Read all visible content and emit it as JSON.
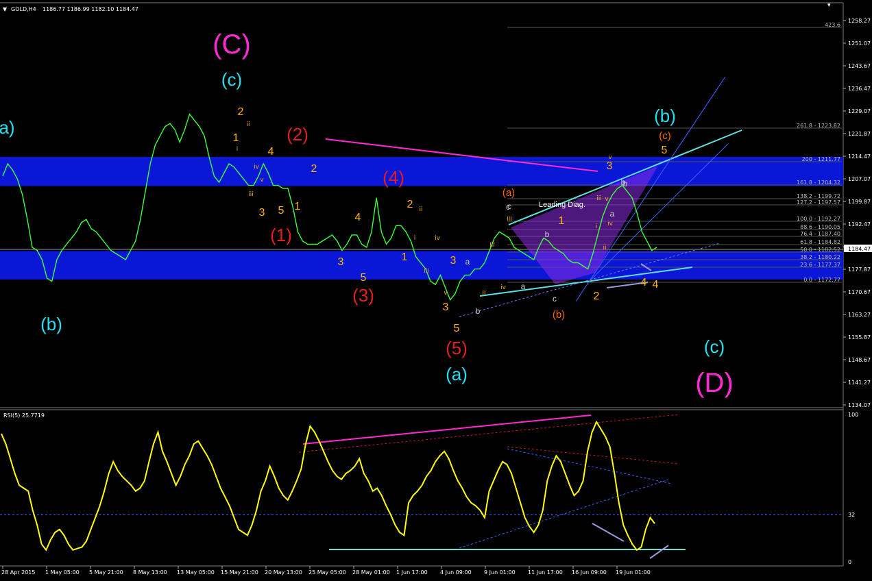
{
  "header": {
    "menu_glyph": "▼",
    "symbol": "GOLD,H4",
    "ohlc": "1186.77 1186.99 1182.10 1184.47"
  },
  "chart_data": {
    "type": "line",
    "title": "GOLD,H4",
    "ylim": [
      1134.07,
      1258.27
    ],
    "y_ticks": [
      "1258.27",
      "1251.07",
      "1243.67",
      "1236.47",
      "1229.07",
      "1221.87",
      "1214.47",
      "1207.07",
      "1199.87",
      "1192.47",
      "1185.27",
      "1177.87",
      "1170.67",
      "1163.27",
      "1155.87",
      "1148.67",
      "1141.27",
      "1134.07"
    ],
    "current_price": "1184.47",
    "x_ticks": [
      "28 Apr 2015",
      "1 May 05:00",
      "5 May 21:00",
      "8 May 13:00",
      "13 May 05:00",
      "15 May 21:00",
      "20 May 13:00",
      "25 May 05:00",
      "28 May 01:00",
      "1 Jun 17:00",
      "4 Jun 09:00",
      "9 Jun 01:00",
      "11 Jun 17:00",
      "16 Jun 09:00",
      "19 Jun 01:00"
    ],
    "price_series": [
      1208,
      1212,
      1210,
      1207,
      1202,
      1194,
      1185,
      1184,
      1181,
      1175,
      1174,
      1181,
      1184,
      1186,
      1188,
      1190,
      1193,
      1194,
      1191,
      1190,
      1188,
      1186,
      1184,
      1183,
      1182,
      1181,
      1184,
      1187,
      1194,
      1203,
      1212,
      1218,
      1221,
      1224,
      1225,
      1223,
      1219,
      1223,
      1228,
      1226,
      1224,
      1221,
      1214,
      1208,
      1206,
      1209,
      1212,
      1211,
      1209,
      1207,
      1205,
      1205,
      1208,
      1212,
      1209,
      1205,
      1205,
      1204,
      1204,
      1198,
      1190,
      1187,
      1186,
      1186,
      1186,
      1187,
      1188,
      1189,
      1187,
      1184,
      1186,
      1189,
      1189,
      1186,
      1185,
      1190,
      1201,
      1190,
      1186,
      1188,
      1192,
      1192,
      1190,
      1187,
      1182,
      1180,
      1178,
      1174,
      1173,
      1176,
      1172,
      1168,
      1170,
      1174,
      1176,
      1176,
      1178,
      1178,
      1180,
      1184,
      1188,
      1190,
      1189,
      1188,
      1185,
      1184,
      1183,
      1182,
      1181,
      1185,
      1188,
      1187,
      1185,
      1184,
      1183,
      1181,
      1180,
      1180,
      1179,
      1178,
      1183,
      1189,
      1195,
      1199,
      1202,
      1204,
      1205,
      1203,
      1201,
      1196,
      1190,
      1187,
      1184,
      1185
    ],
    "annotations": {
      "waves": [
        {
          "text": "(C)",
          "color": "#ff2bd0",
          "size": "big"
        },
        {
          "text": "(c)",
          "color": "#22e0f0"
        },
        {
          "text": "a)",
          "color": "#22e0f0"
        },
        {
          "text": "(b)",
          "color": "#22e0f0"
        },
        {
          "text": "(2)",
          "color": "#e02020"
        },
        {
          "text": "(1)",
          "color": "#e02020"
        },
        {
          "text": "(4)",
          "color": "#e02020"
        },
        {
          "text": "(3)",
          "color": "#e02020"
        },
        {
          "text": "(5)",
          "color": "#e02020"
        },
        {
          "text": "(a)",
          "color": "#22e0f0"
        },
        {
          "text": "(b)",
          "color": "#22e0f0"
        },
        {
          "text": "(c)",
          "color": "#22e0f0"
        },
        {
          "text": "(D)",
          "color": "#ff2bd0",
          "size": "big"
        },
        {
          "text": "(a)",
          "color": "#ff6a00",
          "size": "small"
        },
        {
          "text": "(b)",
          "color": "#ff6a00",
          "size": "small"
        },
        {
          "text": "(c)",
          "color": "#ff6a00",
          "size": "small"
        }
      ],
      "numbers": [
        "2",
        "1",
        "3",
        "4",
        "5",
        "1",
        "3",
        "2",
        "5",
        "4",
        "3",
        "1",
        "2",
        "4",
        "3",
        "5",
        "1",
        "3",
        "2",
        "4",
        "5",
        "a",
        "a",
        "b",
        "b",
        "c",
        "c",
        "b",
        "a",
        "b",
        "c"
      ],
      "roman": [
        "ii",
        "i",
        "iii",
        "iv",
        "v",
        "ii",
        "i",
        "iv",
        "iii",
        "v",
        "iii",
        "iv",
        "ii",
        "i",
        "ii",
        "iii",
        "iv",
        "v",
        "iii",
        "v"
      ],
      "leading_diag": "Leading Diag."
    },
    "fib_levels": [
      "423.6",
      "261.8 - 1223.82",
      "200 - 1211.77",
      "161.8 - 1204.32",
      "138.2 - 1199.72",
      "127.2 - 1197.57",
      "100.0 - 1192.27",
      "88.6 - 1190.05",
      "76.4 - 1187.40",
      "61.8 - 1184.82",
      "50.0 - 1182.52",
      "38.2 - 1180.22",
      "23.6 - 1177.37",
      "0.0 - 1172.77"
    ],
    "rsi": {
      "label": "RSI(5) 25.7719",
      "ylim": [
        0,
        100
      ],
      "y_ticks": [
        "100",
        "32",
        "0"
      ],
      "values": [
        87,
        80,
        70,
        60,
        52,
        50,
        48,
        35,
        25,
        12,
        8,
        15,
        20,
        22,
        18,
        12,
        8,
        9,
        10,
        14,
        22,
        30,
        38,
        48,
        60,
        68,
        62,
        58,
        55,
        52,
        48,
        50,
        55,
        68,
        80,
        88,
        75,
        68,
        60,
        52,
        58,
        66,
        72,
        80,
        82,
        77,
        72,
        66,
        58,
        50,
        44,
        38,
        30,
        22,
        20,
        18,
        25,
        35,
        48,
        55,
        65,
        58,
        50,
        45,
        42,
        48,
        55,
        63,
        80,
        92,
        88,
        82,
        75,
        68,
        62,
        58,
        56,
        60,
        62,
        65,
        70,
        60,
        55,
        48,
        50,
        45,
        38,
        32,
        25,
        20,
        18,
        40,
        45,
        48,
        52,
        58,
        62,
        68,
        72,
        75,
        70,
        62,
        55,
        50,
        44,
        40,
        38,
        35,
        30,
        48,
        55,
        62,
        68,
        66,
        60,
        50,
        40,
        30,
        24,
        20,
        25,
        35,
        55,
        65,
        72,
        68,
        60,
        52,
        45,
        48,
        55,
        75,
        88,
        95,
        90,
        85,
        78,
        60,
        40,
        25,
        18,
        12,
        8,
        10,
        22,
        30,
        26
      ]
    }
  }
}
